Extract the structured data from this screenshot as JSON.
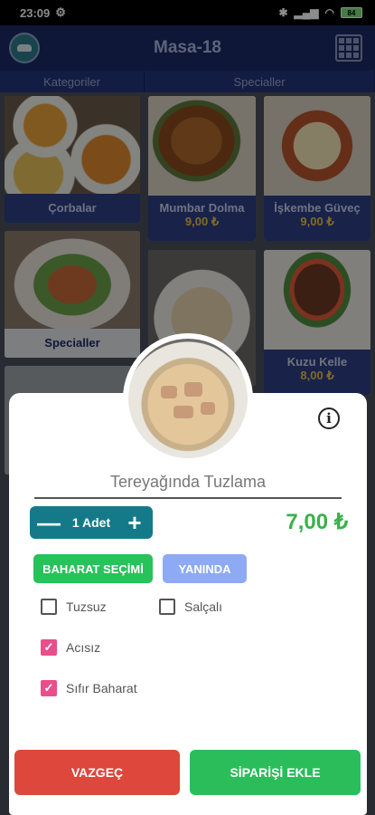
{
  "status": {
    "time": "23:09",
    "battery": "84"
  },
  "app": {
    "title": "Masa-18"
  },
  "tabs": {
    "left": "Kategoriler",
    "right": "Specialler"
  },
  "categories": [
    {
      "label": "Çorbalar"
    },
    {
      "label": "Specialler"
    }
  ],
  "products": [
    {
      "label": "Mumbar Dolma",
      "price": "9,00 ₺"
    },
    {
      "label": "İşkembe Güveç",
      "price": "9,00 ₺"
    },
    {
      "label": "Kuzu Kelle",
      "price": "8,00 ₺"
    }
  ],
  "dialog": {
    "product_name": "Tereyağında Tuzlama",
    "quantity": "1 Adet",
    "price": "7,00 ₺",
    "chip_spices": "BAHARAT SEÇİMİ",
    "chip_side": "YANINDA",
    "options": [
      {
        "label": "Tuzsuz",
        "checked": false
      },
      {
        "label": "Salçalı",
        "checked": false
      },
      {
        "label": "Acısız",
        "checked": true
      },
      {
        "label": "Sıfır Baharat",
        "checked": true
      }
    ],
    "cancel": "VAZGEÇ",
    "add": "SİPARİŞİ EKLE"
  },
  "colors": {
    "appbar": "#1a2b66",
    "accent_green": "#27c25a",
    "cancel_red": "#de473c",
    "check_pink": "#e84f8a",
    "qty_teal": "#147a8a",
    "price_yellow": "#e8c44a"
  },
  "icons": [
    "wifi-icon",
    "signal-icon",
    "bluetooth-icon",
    "grid-icon",
    "info-icon",
    "minus-icon",
    "plus-icon"
  ]
}
